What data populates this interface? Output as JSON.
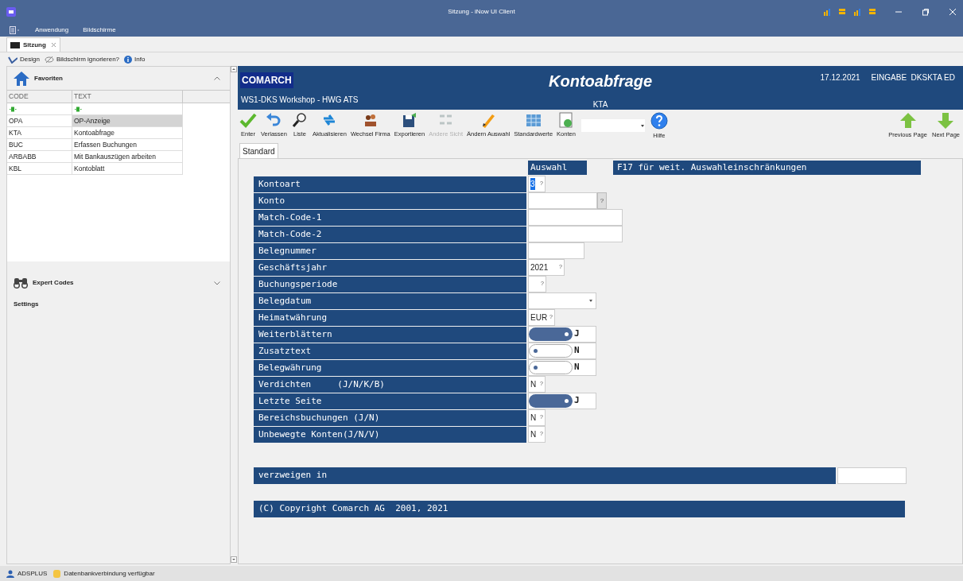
{
  "window": {
    "title": "Sitzung - iNow UI Client"
  },
  "menu": [
    "Anwendung",
    "Bildschirme"
  ],
  "doc_tabs": [
    {
      "label": "Sitzung",
      "selected": true
    }
  ],
  "quick_toolbar": [
    "Design",
    "Bildschirm ignorieren?",
    "Info"
  ],
  "favorites": {
    "title": "Favoriten",
    "columns": [
      "CODE",
      "TEXT"
    ],
    "rows": [
      {
        "code": "OPA",
        "text": "OP-Anzeige",
        "selected": true
      },
      {
        "code": "KTA",
        "text": "Kontoabfrage",
        "selected": false
      },
      {
        "code": "BUC",
        "text": "Erfassen Buchungen",
        "selected": false
      },
      {
        "code": "ARBABB",
        "text": "Mit Bankauszügen arbeiten",
        "selected": false
      },
      {
        "code": "KBL",
        "text": "Kontoblatt",
        "selected": false
      }
    ]
  },
  "expert_codes": {
    "title": "Expert Codes"
  },
  "settings": "Settings",
  "header": {
    "logo": "COMARCH",
    "title": "Kontoabfrage",
    "date": "17.12.2021",
    "mode": "EINGABE  DKSKTA ED",
    "company": "WS1-DKS Workshop - HWG ATS",
    "code": "KTA"
  },
  "toolbar": [
    {
      "label": "Enter",
      "disabled": false
    },
    {
      "label": "Verlassen",
      "disabled": false
    },
    {
      "label": "Liste",
      "disabled": false
    },
    {
      "label": "Aktualisieren",
      "disabled": false
    },
    {
      "label": "Wechsel Firma",
      "disabled": false
    },
    {
      "label": "Exportieren",
      "disabled": false
    },
    {
      "label": "Andere Sicht",
      "disabled": true
    },
    {
      "label": "Ändern Auswahl",
      "disabled": false
    },
    {
      "label": "Standardwerte",
      "disabled": false
    },
    {
      "label": "Konten",
      "disabled": false
    }
  ],
  "help_button": "Hilfe",
  "paging": [
    "Previous Page",
    "Next Page"
  ],
  "form_tabs": [
    {
      "label": "Standard",
      "selected": true
    }
  ],
  "form": {
    "selection_header": "Auswahl",
    "hint": "F17 für weit. Auswahleinschränkungen",
    "fields": [
      {
        "label": "Kontoart",
        "kind": "input",
        "value": "3",
        "help": "?",
        "selected": true
      },
      {
        "label": "Konto",
        "kind": "lookup",
        "help": "?"
      },
      {
        "label": "Match-Code-1",
        "kind": "input"
      },
      {
        "label": "Match-Code-2",
        "kind": "input"
      },
      {
        "label": "Belegnummer",
        "kind": "input"
      },
      {
        "label": "Geschäftsjahr",
        "kind": "input",
        "value": "2021",
        "help": "?"
      },
      {
        "label": "Buchungsperiode",
        "kind": "input",
        "help": "?"
      },
      {
        "label": "Belegdatum",
        "kind": "date"
      },
      {
        "label": "Heimatwährung",
        "kind": "input",
        "value": "EUR",
        "help": "?"
      },
      {
        "label": "Weiterblättern",
        "kind": "toggle",
        "on": true,
        "value": "J"
      },
      {
        "label": "Zusatztext",
        "kind": "toggle",
        "on": false,
        "value": "N"
      },
      {
        "label": "Belegwährung",
        "kind": "toggle",
        "on": false,
        "value": "N"
      },
      {
        "label": "Verdichten     (J/N/K/B)",
        "kind": "input",
        "value": "N",
        "help": "?"
      },
      {
        "label": "Letzte Seite",
        "kind": "toggle",
        "on": true,
        "value": "J"
      },
      {
        "label": "Bereichsbuchungen (J/N)",
        "kind": "input",
        "value": "N",
        "help": "?"
      },
      {
        "label": "Unbewegte Konten(J/N/V)",
        "kind": "input",
        "value": "N",
        "help": "?"
      }
    ],
    "branch": {
      "label": "verzweigen in"
    },
    "copyright": "(C) Copyright Comarch AG  2001, 2021"
  },
  "status_bar": {
    "user": "ADSPLUS",
    "db": "Datenbankverbindung verfügbar"
  }
}
